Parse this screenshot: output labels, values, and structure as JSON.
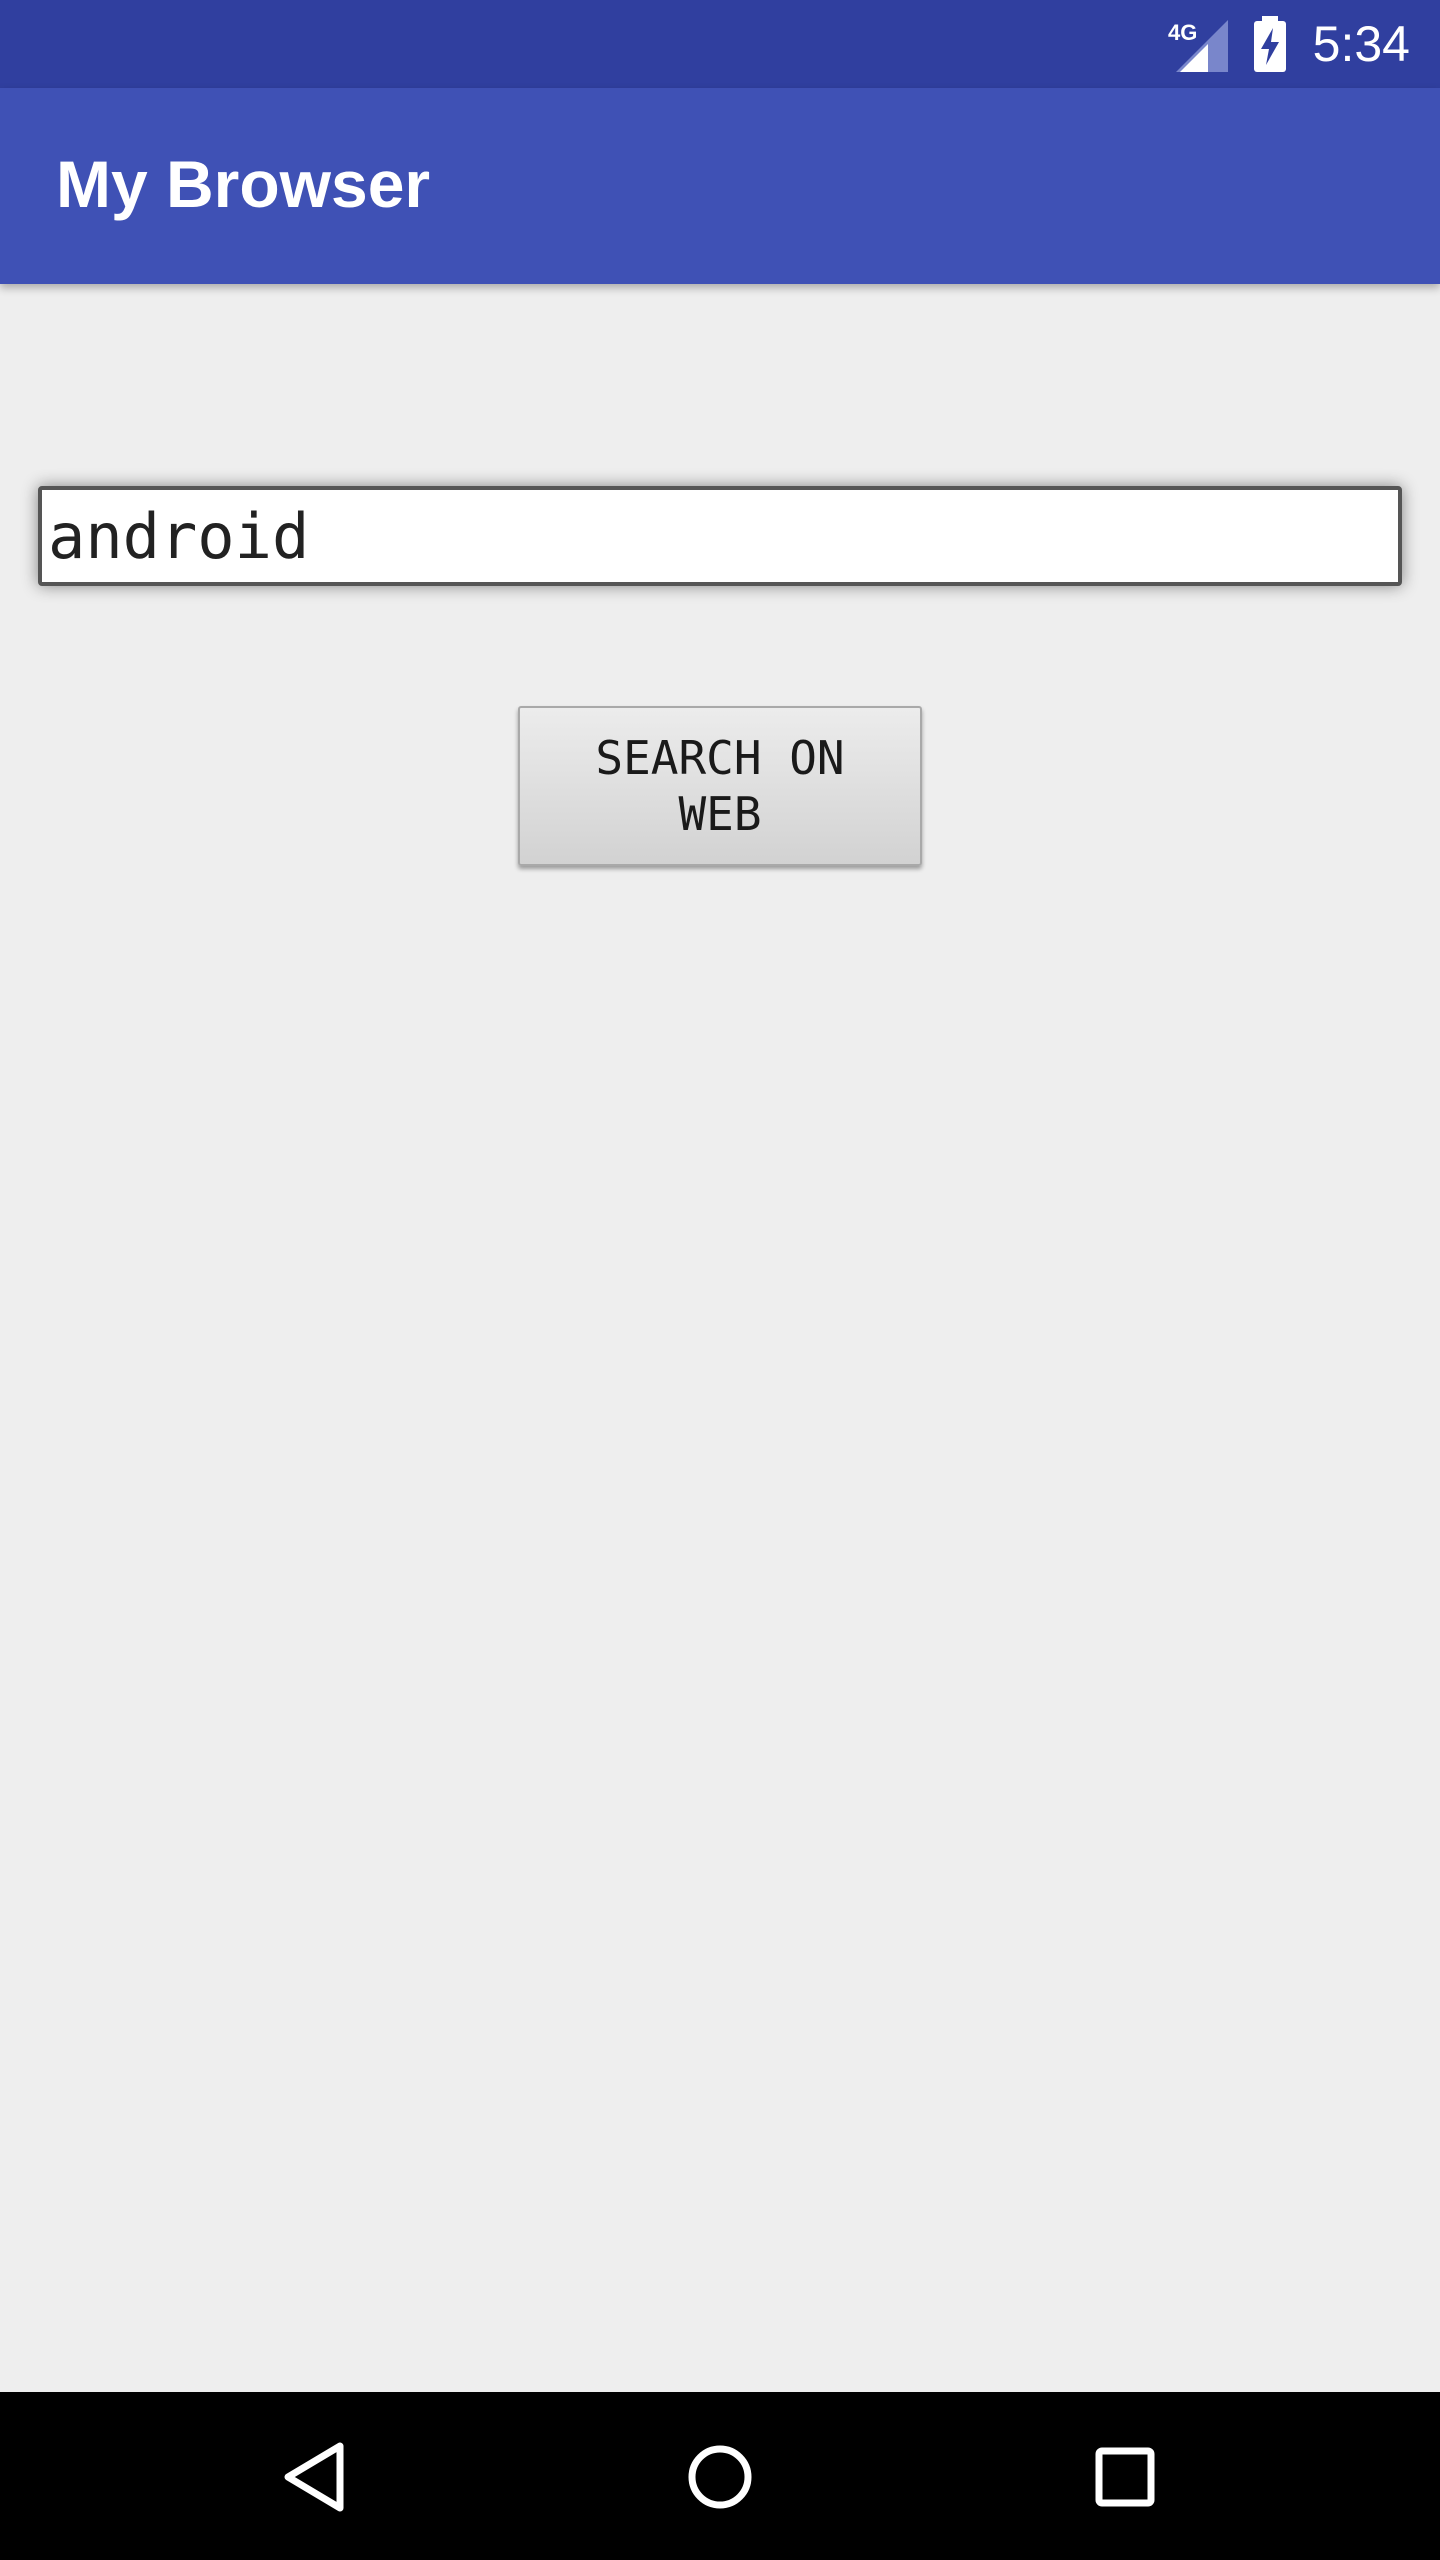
{
  "status_bar": {
    "network": "4G",
    "time": "5:34",
    "background": "#303f9f"
  },
  "app_bar": {
    "title": "My Browser",
    "background": "#3f51b5"
  },
  "search": {
    "value": "android",
    "button_label": "SEARCH ON WEB"
  },
  "navigation": {
    "back_icon": "back-triangle-icon",
    "home_icon": "home-circle-icon",
    "recents_icon": "recents-square-icon"
  }
}
